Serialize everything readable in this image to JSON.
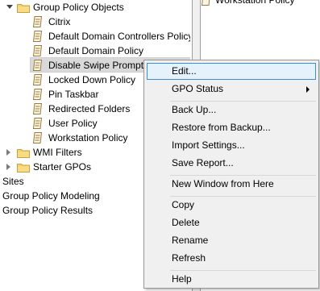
{
  "tree": {
    "group_policy_objects": "Group Policy Objects",
    "gpos": [
      "Citrix",
      "Default Domain Controllers Policy",
      "Default Domain Policy",
      "Disable Swipe Prompts",
      "Locked Down Policy",
      "Pin Taskbar",
      "Redirected Folders",
      "User Policy",
      "Workstation Policy"
    ],
    "selected_gpo": "Disable Swipe Prompts",
    "wmi_filters": "WMI Filters",
    "starter_gpos": "Starter GPOs",
    "sites": "Sites",
    "gp_modeling": "Group Policy Modeling",
    "gp_results": "Group Policy Results"
  },
  "right_pane": {
    "visible_item": "Workstation Policy"
  },
  "context_menu": {
    "items": [
      "Edit...",
      "GPO Status",
      "Back Up...",
      "Restore from Backup...",
      "Import Settings...",
      "Save Report...",
      "New Window from Here",
      "Copy",
      "Delete",
      "Rename",
      "Refresh",
      "Help"
    ],
    "highlighted": "Edit..."
  },
  "colors": {
    "menu_bg": "#f0f0f0",
    "menu_highlight": "#e5f1fb",
    "menu_highlight_border": "#3c8fd6",
    "selection_bg": "#d9d9d9"
  }
}
